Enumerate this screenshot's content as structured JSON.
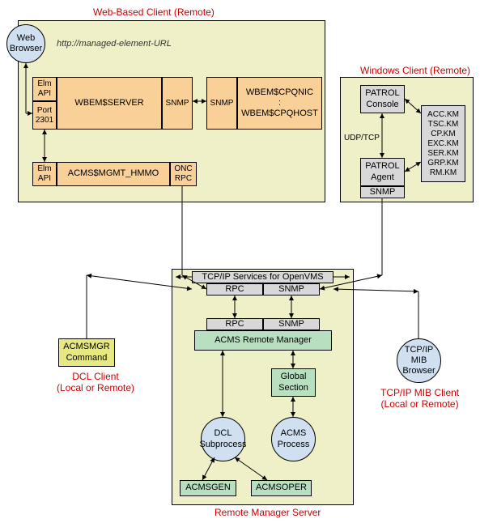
{
  "groups": {
    "web": "Web-Based Client (Remote)",
    "win": "Windows Client (Remote)",
    "rms": "Remote Manager Server",
    "dcl": "DCL Client\n(Local or Remote)",
    "mib": "TCP/IP MIB Client\n(Local or Remote)"
  },
  "url": "http://managed-element-URL",
  "web": {
    "browser": "Web\nBrowser",
    "elm1": "Elm\nAPI",
    "port": "Port\n2301",
    "wbem": "WBEM$SERVER",
    "snmp_out": "SNMP",
    "snmp_in": "SNMP",
    "cpq": "WBEM$CPQNIC\n:\nWBEM$CPQHOST",
    "elm2": "Elm\nAPI",
    "acms": "ACMS$MGMT_HMMO",
    "onc": "ONC\nRPC"
  },
  "win": {
    "console": "PATROL\nConsole",
    "agent": "PATROL\nAgent",
    "snmp": "SNMP",
    "km": "ACC.KM\nTSC.KM\nCP.KM\nEXC.KM\nSER.KM\nGRP.KM\nRM.KM",
    "udp": "UDP/TCP"
  },
  "rms": {
    "tcpip": "TCP/IP Services for OpenVMS",
    "rpc1": "RPC",
    "snmp1": "SNMP",
    "rpc2": "RPC",
    "snmp2": "SNMP",
    "mgr": "ACMS Remote Manager",
    "global": "Global\nSection",
    "dclsub": "DCL\nSubprocess",
    "acmsproc": "ACMS\nProcess",
    "gen": "ACMSGEN",
    "oper": "ACMSOPER"
  },
  "dcl": {
    "cmd": "ACMSMGR\nCommand"
  },
  "mibclient": {
    "browser": "TCP/IP\nMIB\nBrowser"
  }
}
